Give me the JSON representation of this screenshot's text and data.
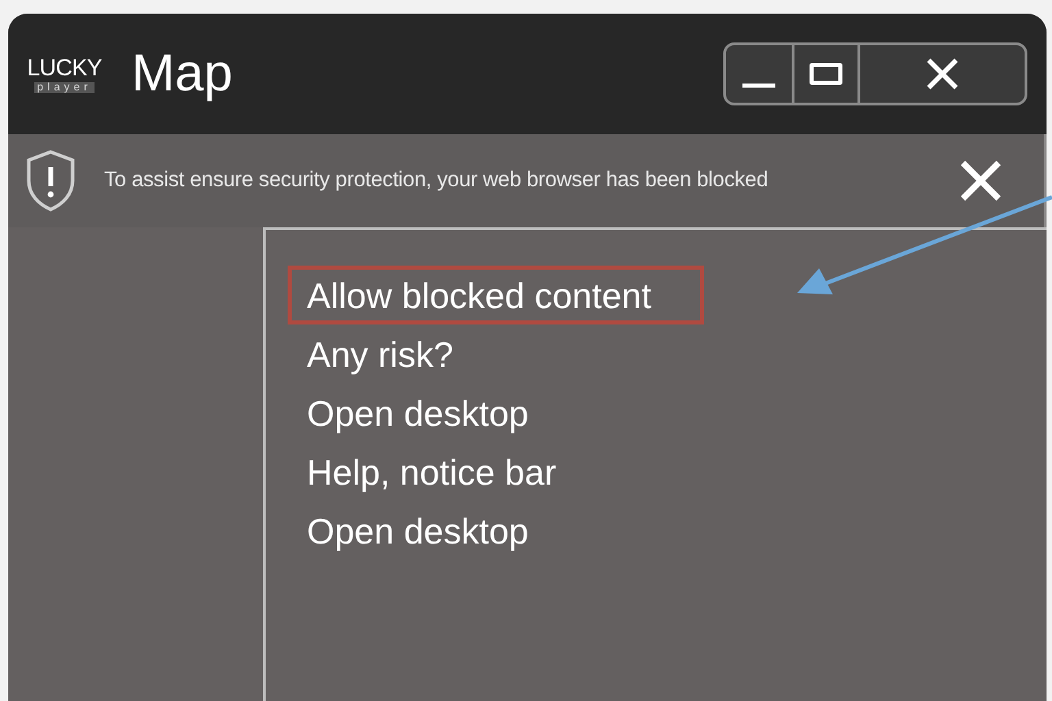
{
  "window": {
    "logo": {
      "name": "LUCKY",
      "subtitle": "player"
    },
    "title": "Map"
  },
  "notice": {
    "text": "To assist ensure security protection, your web browser has been blocked"
  },
  "menu": {
    "items": [
      {
        "label": "Allow blocked content",
        "selected": true
      },
      {
        "label": "Any risk?",
        "selected": false
      },
      {
        "label": "Open desktop",
        "selected": false
      },
      {
        "label": "Help, notice bar",
        "selected": false
      },
      {
        "label": "Open desktop",
        "selected": false
      }
    ]
  },
  "annotation": {
    "kind": "arrow"
  }
}
